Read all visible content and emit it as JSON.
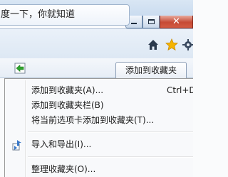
{
  "window": {
    "close_glyph": "✕"
  },
  "tab": {
    "search_text": "度一下，你就知道"
  },
  "toolbar": {
    "icons": [
      "home-icon",
      "star-icon",
      "gear-icon"
    ],
    "page_icon": "page-go-icon",
    "add_favorites_label": "添加到收藏夹"
  },
  "menu": {
    "items": [
      {
        "label": "添加到收藏夹(A)...",
        "shortcut": "Ctrl+D"
      },
      {
        "label": "添加到收藏夹栏(B)",
        "shortcut": ""
      },
      {
        "label": "将当前选项卡添加到收藏夹(T)...",
        "shortcut": ""
      },
      {
        "label": "导入和导出(I)...",
        "shortcut": "",
        "icon": "import-export-icon"
      },
      {
        "label": "整理收藏夹(O)...",
        "shortcut": ""
      }
    ]
  },
  "colors": {
    "close_button": "#c64a35",
    "star": "#f5b400",
    "menu_bg": "#f8f9fb"
  }
}
